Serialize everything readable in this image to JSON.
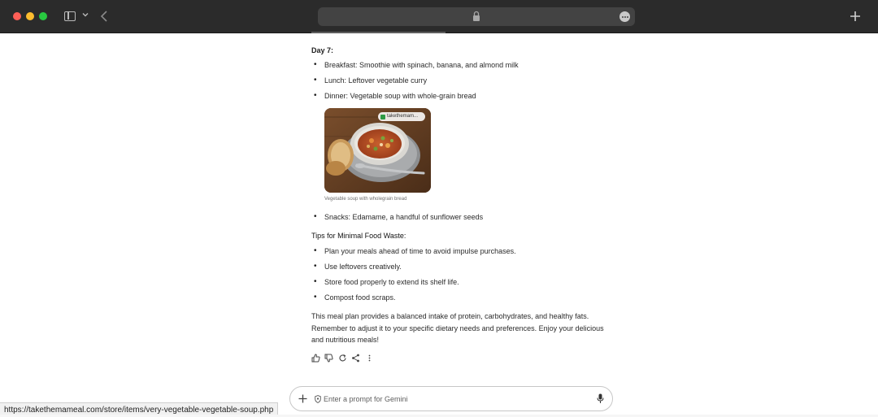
{
  "browser": {
    "colors": {
      "close": "#fe5f57",
      "minimize": "#febc2e",
      "maximize": "#28c840",
      "chrome": "#2b2b2b"
    }
  },
  "content": {
    "day_heading": "Day 7:",
    "day_items": [
      "Breakfast: Smoothie with spinach, banana, and almond milk",
      "Lunch: Leftover vegetable curry",
      "Dinner: Vegetable soup with whole-grain bread"
    ],
    "image": {
      "source_label": "takethemam...",
      "caption": "Vegetable soup with wholegrain bread"
    },
    "snack_item": "Snacks: Edamame, a handful of sunflower seeds",
    "tips_heading": "Tips for Minimal Food Waste:",
    "tips": [
      "Plan your meals ahead of time to avoid impulse purchases.",
      "Use leftovers creatively.",
      "Store food properly to extend its shelf life.",
      "Compost food scraps."
    ],
    "closing_paragraph": "This meal plan provides a balanced intake of protein, carbohydrates, and healthy fats. Remember to adjust it to your specific dietary needs and preferences. Enjoy your delicious and nutritious meals!"
  },
  "response_actions": [
    "thumbs-up-icon",
    "thumbs-down-icon",
    "regenerate-icon",
    "share-icon",
    "more-vert-icon"
  ],
  "prompt": {
    "placeholder": "Enter a prompt for Gemini"
  },
  "status_bar": {
    "url": "https://takethemameal.com/store/items/very-vegetable-vegetable-soup.php"
  }
}
